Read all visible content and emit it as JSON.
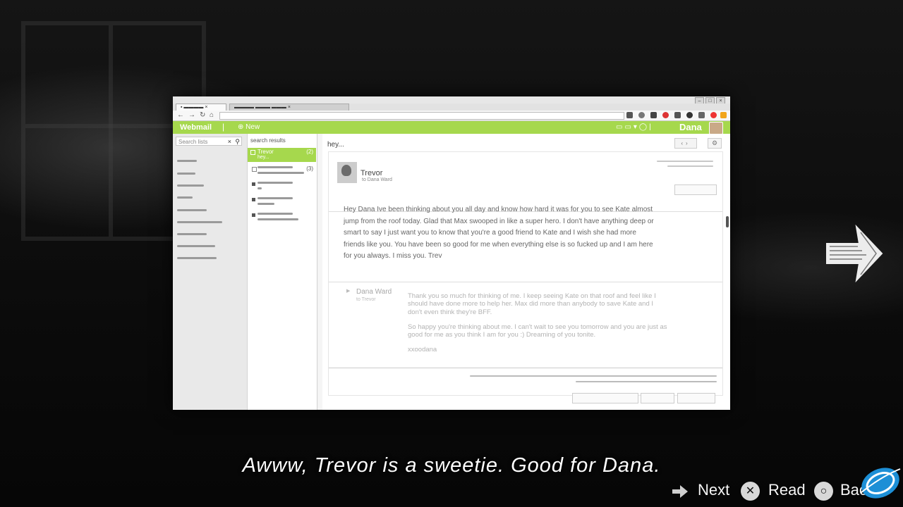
{
  "mail": {
    "brand": "Webmail",
    "new_label": "New",
    "user_name": "Dana",
    "folder_search_placeholder": "Search lists",
    "results_header": "search results",
    "selected_message": {
      "from": "Trevor",
      "preview": "hey...",
      "count": "(2)"
    },
    "second_message_count": "(3)",
    "subject": "hey...",
    "sender": "Trevor",
    "recipient": "to Dana Ward",
    "body": "Hey Dana Ive been thinking about you all day and know how hard it was for you to see Kate almost jump from the roof today. Glad that Max swooped in like a super hero. I don't have anything deep or smart to say I just want you to know that you're a good friend to Kate and I wish she had more friends like you. You have been so good for me when everything else is so fucked up and I am here for you always. I miss you. Trev",
    "reply": {
      "sender": "Dana Ward",
      "recipient": "to Trevor",
      "paragraph1": "Thank you so much for thinking of me. I keep seeing Kate on that roof and feel like I should have done more to help her. Max did more than anybody to save Kate and I don't even think they're BFF.",
      "paragraph2": "So happy you're thinking about me. I can't wait to see you tomorrow and you are just as good for me as you think I am for you :) Dreaming of you tonite.",
      "signoff": "xxoodana"
    }
  },
  "subtitle": "Awww, Trevor is a sweetie.  Good for Dana.",
  "prompts": {
    "next": "Next",
    "read": "Read",
    "back": "Back"
  },
  "icons": {
    "back": "arrow-left-icon",
    "forward": "arrow-right-icon",
    "reload": "reload-icon",
    "new": "plus-circle-icon",
    "search": "magnifier-icon",
    "close": "x-icon",
    "gear": "gear-icon",
    "next_prompt": "stick-icon",
    "read_prompt": "cross-button-icon",
    "back_prompt": "circle-button-icon",
    "hand_drawn_arrow": "arrow-right-icon"
  },
  "colors": {
    "accent": "#a6d84d",
    "text": "#666666",
    "quoted": "#b3b3b3"
  }
}
